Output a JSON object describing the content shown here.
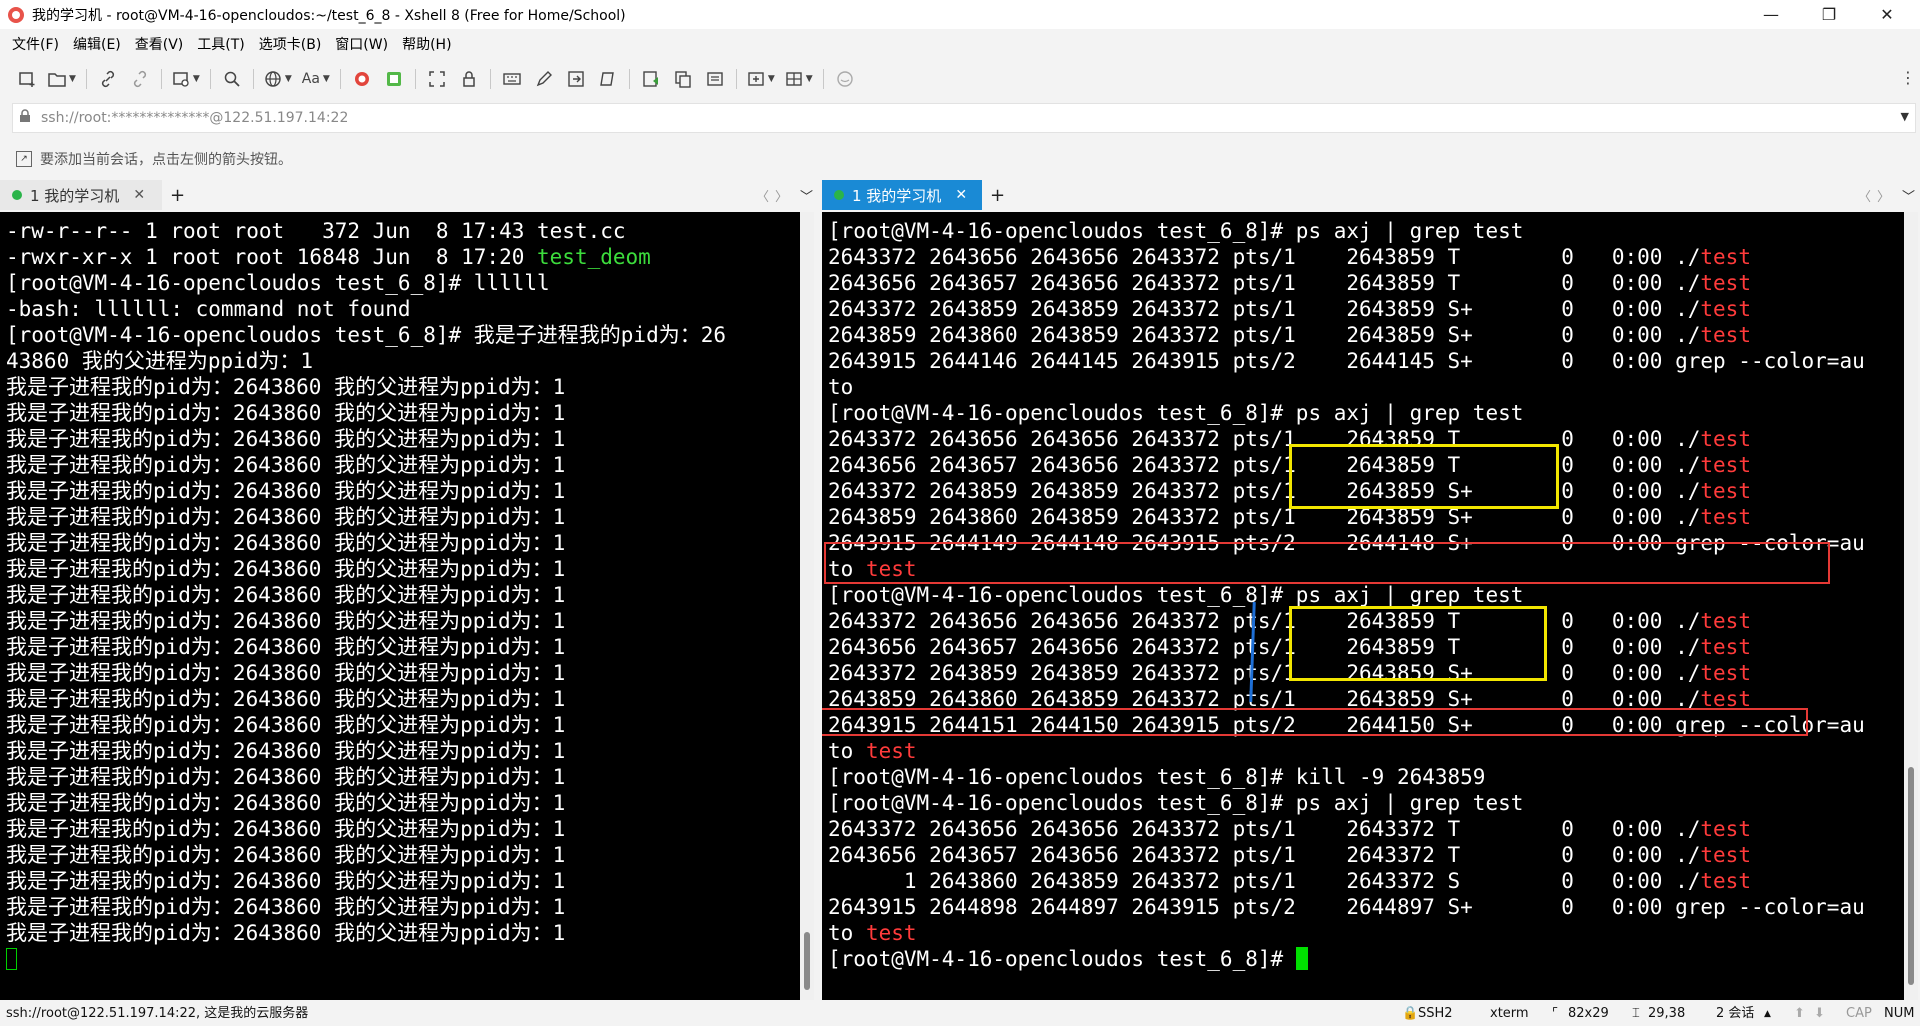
{
  "window": {
    "title": "我的学习机 - root@VM-4-16-opencloudos:~/test_6_8 - Xshell 8 (Free for Home/School)",
    "controls": {
      "minimize": "—",
      "maximize": "❐",
      "close": "✕"
    }
  },
  "menu": [
    "文件(F)",
    "编辑(E)",
    "查看(V)",
    "工具(T)",
    "选项卡(B)",
    "窗口(W)",
    "帮助(H)"
  ],
  "toolbar": {
    "font_label": "Aa"
  },
  "address": {
    "value": "ssh://root:**************@122.51.197.14:22"
  },
  "hint": {
    "text": "要添加当前会话，点击左侧的箭头按钮。"
  },
  "left_tab": {
    "label": "1 我的学习机",
    "close": "✕",
    "plus": "+"
  },
  "right_tab": {
    "label": "1 我的学习机",
    "close": "✕",
    "plus": "+"
  },
  "tab_nav": {
    "prev": "〈",
    "next": "〉",
    "menu": "﹀"
  },
  "left_terminal": {
    "line1": "-rw-r--r-- 1 root root   372 Jun  8 17:43 test.cc",
    "line2_prefix": "-rwxr-xr-x 1 root root 16848 Jun  8 17:20 ",
    "line2_exec": "test_deom",
    "line3": "[root@VM-4-16-opencloudos test_6_8]# llllll",
    "line4": "-bash: llllll: command not found",
    "line5": "[root@VM-4-16-opencloudos test_6_8]# 我是子进程我的pid为：26",
    "line6": "43860 我的父进程为ppid为：1",
    "repeat_line": "我是子进程我的pid为：2643860 我的父进程为ppid为：1",
    "repeat_count": 22
  },
  "right_terminal": {
    "prompt": "[root@VM-4-16-opencloudos test_6_8]#",
    "cmd_ps": " ps axj | grep test",
    "cmd_kill": " kill -9 2643859",
    "dot_slash": "./",
    "test": "test",
    "grep_tail": "grep --color=au",
    "to_word": "to ",
    "block1": [
      "2643372 2643656 2643656 2643372 pts/1    2643859 T        0   0:00 ",
      "2643656 2643657 2643656 2643372 pts/1    2643859 T        0   0:00 ",
      "2643372 2643859 2643859 2643372 pts/1    2643859 S+       0   0:00 ",
      "2643859 2643860 2643859 2643372 pts/1    2643859 S+       0   0:00 "
    ],
    "block1_grep": "2643915 2644146 2644145 2643915 pts/2    2644145 S+       0   0:00 ",
    "block1_to": "to",
    "block2": [
      "2643372 2643656 2643656 2643372 pts/1    2643859 T        0   0:00 ",
      "2643656 2643657 2643656 2643372 pts/1    2643859 T        0   0:00 ",
      "2643372 2643859 2643859 2643372 pts/1    2643859 S+       0   0:00 ",
      "2643859 2643860 2643859 2643372 pts/1    2643859 S+       0   0:00 "
    ],
    "block2_grep": "2643915 2644149 2644148 2643915 pts/2    2644148 S+       0   0:00 ",
    "block3": [
      "2643372 2643656 2643656 2643372 pts/1    2643859 T        0   0:00 ",
      "2643656 2643657 2643656 2643372 pts/1    2643859 T        0   0:00 ",
      "2643372 2643859 2643859 2643372 pts/1    2643859 S+       0   0:00 ",
      "2643859 2643860 2643859 2643372 pts/1    2643859 S+       0   0:00 "
    ],
    "block3_grep": "2643915 2644151 2644150 2643915 pts/2    2644150 S+       0   0:00 ",
    "block4": [
      "2643372 2643656 2643656 2643372 pts/1    2643372 T        0   0:00 ",
      "2643656 2643657 2643656 2643372 pts/1    2643372 T        0   0:00 ",
      "      1 2643860 2643859 2643372 pts/1    2643372 S        0   0:00 "
    ],
    "block4_grep": "2643915 2644898 2644897 2643915 pts/2    2644897 S+       0   0:00 "
  },
  "colors": {
    "terminal_bg": "#000000",
    "terminal_fg": "#ffffff",
    "highlight_red": "#ff3b3b",
    "exec_green": "#3cdc3c",
    "annotation_yellow": "#f2e600",
    "annotation_red": "#e53935",
    "active_tab_blue": "#1a8ad5"
  },
  "status": {
    "left": "ssh://root@122.51.197.14:22, 这是我的云服务器",
    "protocol": "SSH2",
    "term": "xterm",
    "size": "82x29",
    "cursor_pos": "29,38",
    "sessions": "2 会话",
    "cap": "CAP",
    "num": "NUM"
  }
}
